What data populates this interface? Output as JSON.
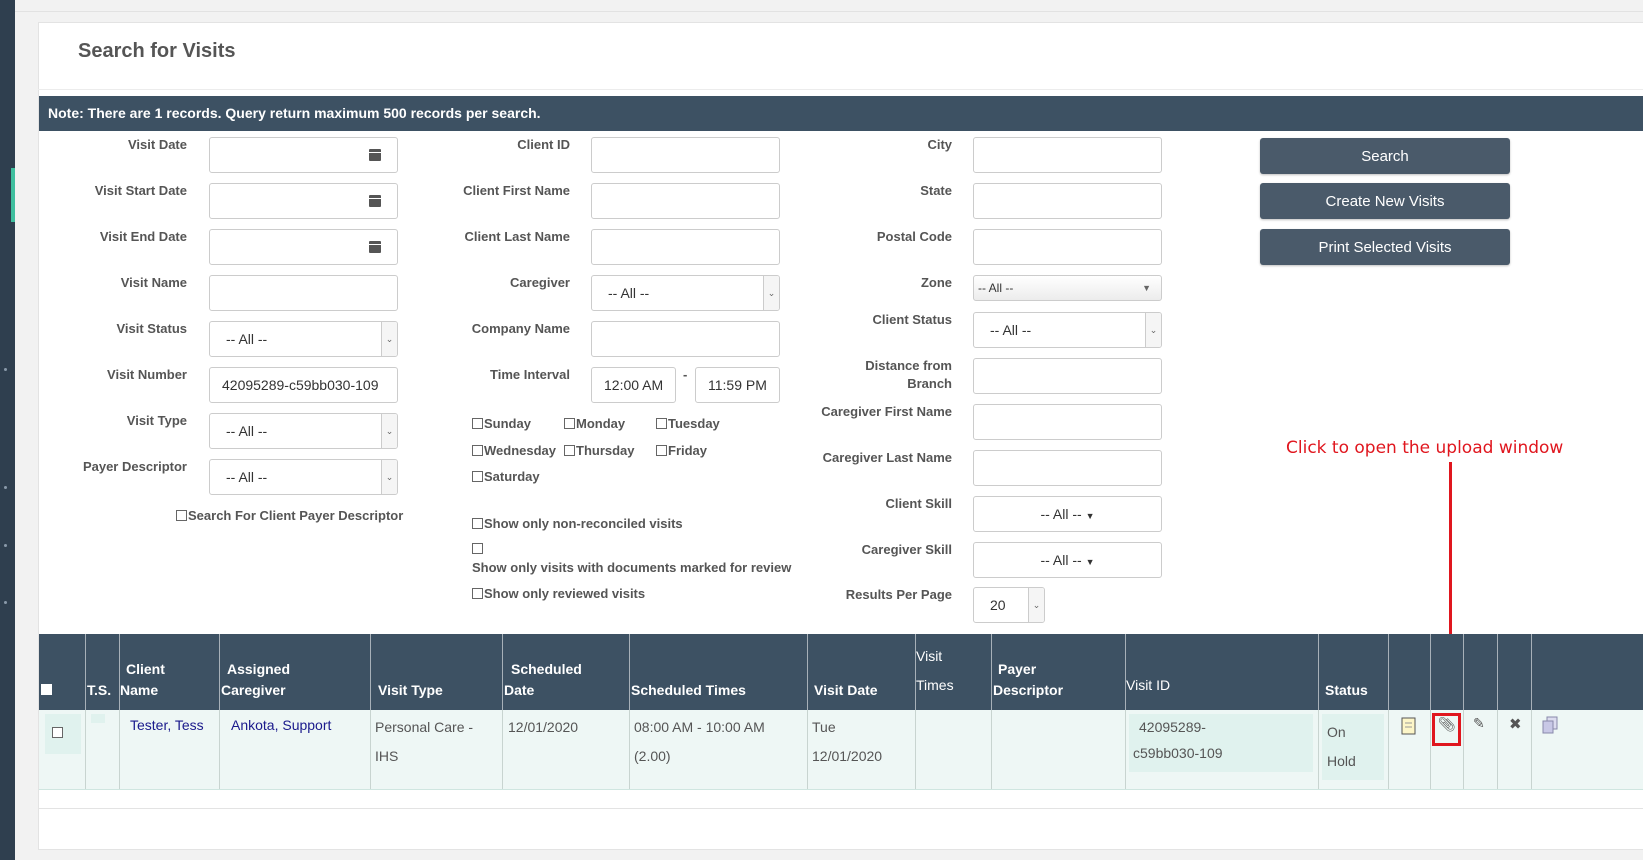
{
  "page": {
    "title": "Search for Visits",
    "note": "Note: There are 1 records. Query return maximum 500 records per search."
  },
  "col1": {
    "visit_date": {
      "label": "Visit Date",
      "value": ""
    },
    "visit_start_date": {
      "label": "Visit Start Date",
      "value": ""
    },
    "visit_end_date": {
      "label": "Visit End Date",
      "value": ""
    },
    "visit_name": {
      "label": "Visit Name",
      "value": ""
    },
    "visit_status": {
      "label": "Visit Status",
      "value": "-- All --"
    },
    "visit_number": {
      "label": "Visit Number",
      "value": "42095289-c59bb030-109"
    },
    "visit_type": {
      "label": "Visit Type",
      "value": "-- All --"
    },
    "payer_descriptor": {
      "label": "Payer Descriptor",
      "value": "-- All --"
    },
    "client_payer_check": "Search For Client Payer Descriptor"
  },
  "col2": {
    "client_id": {
      "label": "Client ID",
      "value": ""
    },
    "client_first_name": {
      "label": "Client First Name",
      "value": ""
    },
    "client_last_name": {
      "label": "Client Last Name",
      "value": ""
    },
    "caregiver": {
      "label": "Caregiver",
      "value": "-- All --"
    },
    "company_name": {
      "label": "Company Name",
      "value": ""
    },
    "time_interval": {
      "label": "Time Interval",
      "start": "12:00 AM",
      "end": "11:59 PM",
      "sep": "-"
    },
    "days": [
      "Sunday",
      "Monday",
      "Tuesday",
      "Wednesday",
      "Thursday",
      "Friday",
      "Saturday"
    ],
    "non_reconciled": "Show only non-reconciled visits",
    "docs_review": "Show only visits with documents marked for review",
    "reviewed": "Show only reviewed visits"
  },
  "col3": {
    "city": {
      "label": "City",
      "value": ""
    },
    "state": {
      "label": "State",
      "value": ""
    },
    "postal_code": {
      "label": "Postal Code",
      "value": ""
    },
    "zone": {
      "label": "Zone",
      "value": "-- All --"
    },
    "client_status": {
      "label": "Client Status",
      "value": "-- All --"
    },
    "distance_line1": "Distance from",
    "distance_line2": "Branch",
    "caregiver_first_name": {
      "label": "Caregiver First Name",
      "value": ""
    },
    "caregiver_last_name": {
      "label": "Caregiver Last Name",
      "value": ""
    },
    "client_skill": {
      "label": "Client Skill",
      "value": "-- All --"
    },
    "caregiver_skill": {
      "label": "Caregiver Skill",
      "value": "-- All --"
    },
    "results_per_page": {
      "label": "Results Per Page",
      "value": "20"
    }
  },
  "buttons": {
    "search": "Search",
    "create": "Create New Visits",
    "print": "Print Selected Visits"
  },
  "annotation": "Click to open the upload window",
  "table": {
    "headers": {
      "ts": "T.S.",
      "client_1": "Client",
      "client_2": "Name",
      "caregiver_1": "Assigned",
      "caregiver_2": "Caregiver",
      "visit_type": "Visit Type",
      "sched_date_1": "Scheduled",
      "sched_date_2": "Date",
      "sched_times": "Scheduled Times",
      "visit_date": "Visit Date",
      "visit_times_1": "Visit",
      "visit_times_2": "Times",
      "payer_1": "Payer",
      "payer_2": "Descriptor",
      "visit_id": "Visit ID",
      "status": "Status"
    },
    "row": {
      "client": "Tester, Tess",
      "caregiver": "Ankota, Support",
      "visit_type_1": "Personal Care -",
      "visit_type_2": "IHS",
      "sched_date": "12/01/2020",
      "sched_times_1": "08:00 AM - 10:00 AM",
      "sched_times_2": "(2.00)",
      "visit_date_1": "Tue",
      "visit_date_2": "12/01/2020",
      "visit_id_1": "42095289-",
      "visit_id_2": "c59bb030-109",
      "status_1": "On",
      "status_2": "Hold"
    }
  }
}
